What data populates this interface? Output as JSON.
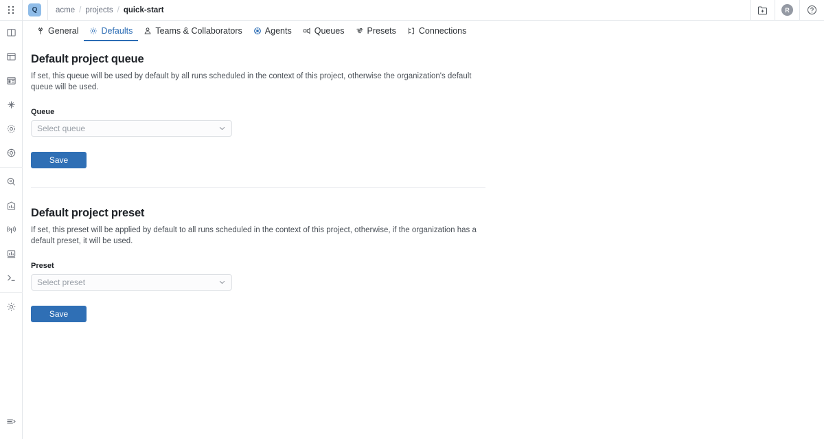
{
  "topbar": {
    "grip_icon": "grip-dots-icon",
    "org_badge": {
      "label": "Q",
      "name": "org-badge",
      "color": "#8fbce8"
    },
    "breadcrumb": {
      "org": "acme",
      "section": "projects",
      "current": "quick-start",
      "separator": "/"
    },
    "actions": [
      {
        "name": "new-folder-icon",
        "icon": "folder-plus-icon",
        "label": ""
      },
      {
        "name": "user-avatar",
        "icon": "avatar",
        "label": "R"
      },
      {
        "name": "help-icon",
        "icon": "question-circle-icon",
        "label": ""
      }
    ]
  },
  "rail": {
    "items": [
      {
        "name": "sidebar-item-panels",
        "icon": "columns-icon"
      },
      {
        "name": "sidebar-item-table",
        "icon": "table-icon"
      },
      {
        "name": "sidebar-item-layout",
        "icon": "layout-sidebar-icon"
      },
      {
        "name": "sidebar-item-workflow",
        "icon": "share-nodes-icon"
      },
      {
        "name": "sidebar-item-cluster",
        "icon": "dotted-circle-icon"
      },
      {
        "name": "sidebar-item-target",
        "icon": "target-icon"
      },
      {
        "name": "sidebar-item-inspect",
        "icon": "magnifier-icon"
      },
      {
        "name": "sidebar-item-insights",
        "icon": "chart-bars-icon"
      },
      {
        "name": "sidebar-item-broadcast",
        "icon": "signal-icon"
      },
      {
        "name": "sidebar-item-metrics",
        "icon": "bar-chart-icon"
      },
      {
        "name": "sidebar-item-terminal",
        "icon": "terminal-icon"
      }
    ],
    "settings": {
      "name": "sidebar-item-settings",
      "icon": "gear-icon"
    },
    "collapse": {
      "name": "sidebar-collapse-toggle",
      "icon": "collapse-arrow-icon"
    }
  },
  "tabs": [
    {
      "label": "General",
      "icon": "wrench-icon",
      "active": false
    },
    {
      "label": "Defaults",
      "icon": "gear-icon",
      "active": true
    },
    {
      "label": "Teams & Collaborators",
      "icon": "person-icon",
      "active": false
    },
    {
      "label": "Agents",
      "icon": "agent-icon",
      "active": false
    },
    {
      "label": "Queues",
      "icon": "queues-icon",
      "active": false
    },
    {
      "label": "Presets",
      "icon": "sliders-icon",
      "active": false
    },
    {
      "label": "Connections",
      "icon": "connections-icon",
      "active": false
    }
  ],
  "sections": [
    {
      "title": "Default project queue",
      "description": "If set, this queue will be used by default by all runs scheduled in the context of this project, otherwise the organization's default queue will be used.",
      "field_label": "Queue",
      "select_placeholder": "Select queue",
      "select_value": "",
      "save_label": "Save"
    },
    {
      "title": "Default project preset",
      "description": "If set, this preset will be applied by default to all runs scheduled in the context of this project, otherwise, if the organization has a default preset, it will be used.",
      "field_label": "Preset",
      "select_placeholder": "Select preset",
      "select_value": "",
      "save_label": "Save"
    }
  ],
  "theme": {
    "accent": "#2b6cb4",
    "button": "#2f6fb5",
    "border": "#e3e6ea",
    "text": "#1f2328",
    "muted": "#6b7280"
  }
}
